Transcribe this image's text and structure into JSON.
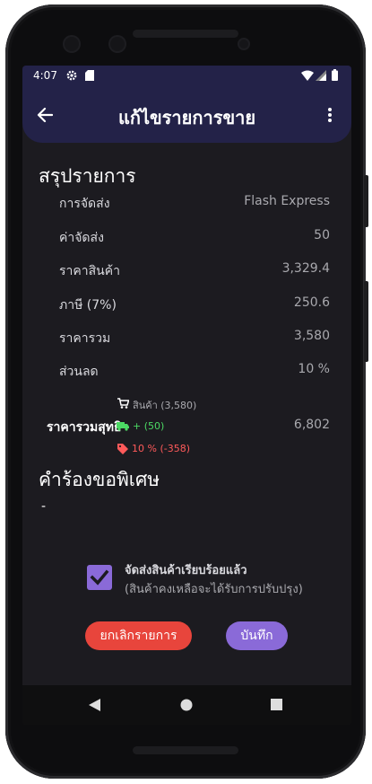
{
  "status": {
    "time": "4:07"
  },
  "appbar": {
    "title": "แก้ไขรายการขาย"
  },
  "summary": {
    "title": "สรุปรายการ",
    "rows": [
      {
        "label": "การจัดส่ง",
        "value": "Flash Express"
      },
      {
        "label": "ค่าจัดส่ง",
        "value": "50"
      },
      {
        "label": "ราคาสินค้า",
        "value": "3,329.4"
      },
      {
        "label": "ภาษี (7%)",
        "value": "250.6"
      },
      {
        "label": "ราคารวม",
        "value": "3,580"
      },
      {
        "label": "ส่วนลด",
        "value": "10 %"
      }
    ],
    "breakdown": {
      "products": "สินค้า (3,580)",
      "shipping": "+ (50)",
      "discount": "10 % (-358)"
    },
    "net_label": "ราคารวมสุทธิ",
    "net_value": "6,802"
  },
  "special": {
    "title": "คำร้องขอพิเศษ",
    "value": "-"
  },
  "shipped": {
    "label": "จัดส่งสินค้าเรียบร้อยแล้ว",
    "note": "(สินค้าคงเหลือจะได้รับการปรับปรุง)",
    "checked": true
  },
  "actions": {
    "cancel": "ยกเลิกรายการ",
    "save": "บันทึก"
  },
  "colors": {
    "appbar": "#232248",
    "background": "#1c1b20",
    "accent": "#8a6ad8",
    "cancel": "#e8453c",
    "shipping_green": "#4cd964",
    "discount_red": "#ff5a5a"
  }
}
